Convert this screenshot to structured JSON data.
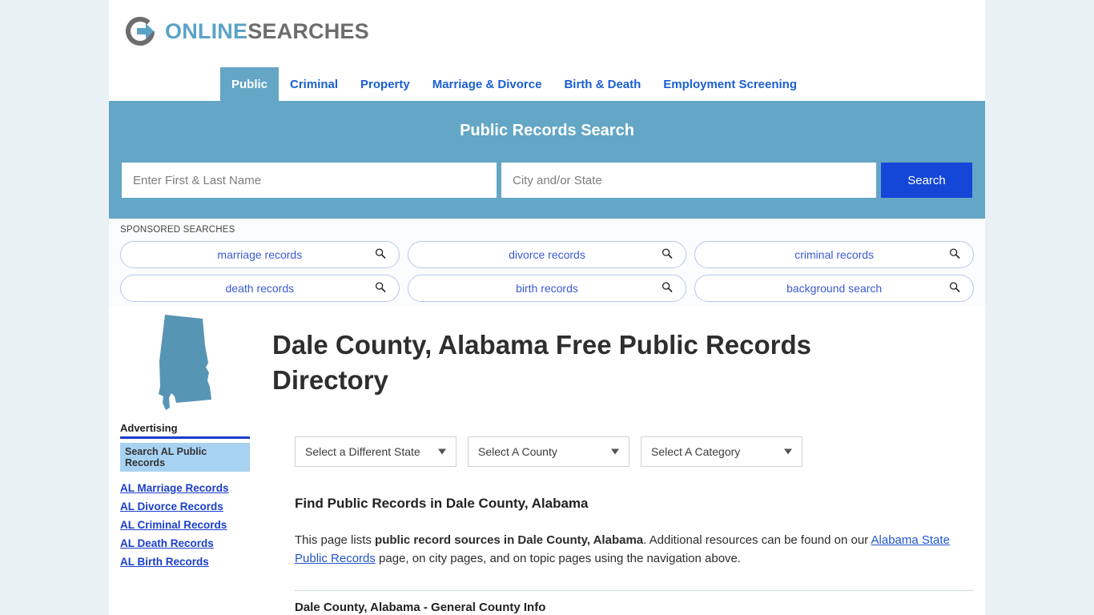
{
  "brand": {
    "logo_icon": "circle-arrow-icon",
    "name_part1": "ONLINE",
    "name_part2": "SEARCHES",
    "accent_blue": "#5ba3c6",
    "accent_gray": "#6d6d6d"
  },
  "nav": {
    "tabs": [
      {
        "label": "Public",
        "active": true
      },
      {
        "label": "Criminal",
        "active": false
      },
      {
        "label": "Property",
        "active": false
      },
      {
        "label": "Marriage & Divorce",
        "active": false
      },
      {
        "label": "Birth & Death",
        "active": false
      },
      {
        "label": "Employment Screening",
        "active": false
      }
    ]
  },
  "hero": {
    "title": "Public Records Search",
    "name_placeholder": "Enter First & Last Name",
    "name_value": "",
    "location_placeholder": "City and/or State",
    "location_value": "",
    "search_label": "Search",
    "background": "#63a6c5",
    "button_color": "#1446d8"
  },
  "sponsored": {
    "label": "SPONSORED SEARCHES",
    "icon": "magnifier-icon",
    "items": [
      "marriage records",
      "divorce records",
      "criminal records",
      "death records",
      "birth records",
      "background search"
    ]
  },
  "main": {
    "state_map_icon": "alabama-state-map",
    "page_title": "Dale County, Alabama Free Public Records Directory",
    "selects": [
      {
        "name": "state",
        "value": "Select a Different State"
      },
      {
        "name": "county",
        "value": "Select A County"
      },
      {
        "name": "category",
        "value": "Select A Category"
      }
    ],
    "section_heading": "Find Public Records in Dale County, Alabama",
    "paragraph": {
      "p1": "This page lists ",
      "bold": "public record sources in Dale County, Alabama",
      "p2": ". Additional resources can be found on our ",
      "link": "Alabama State Public Records",
      "p3": " page, on city pages, and on topic pages using the navigation above."
    },
    "next_section_heading": "Dale County, Alabama - General County Info"
  },
  "sidebar": {
    "title": "Advertising",
    "ad_headline": "Search AL Public Records",
    "links": [
      "AL Marriage Records",
      "AL Divorce Records",
      "AL Criminal Records",
      "AL Death Records",
      "AL Birth Records"
    ]
  }
}
